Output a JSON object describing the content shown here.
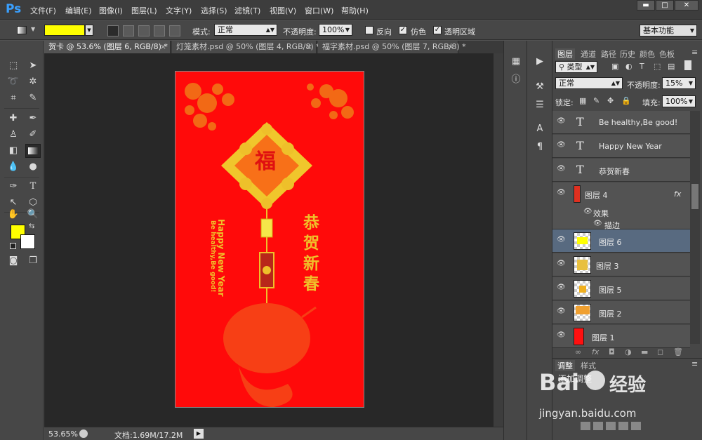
{
  "app": {
    "logo": "Ps"
  },
  "menu": [
    "文件(F)",
    "编辑(E)",
    "图像(I)",
    "图层(L)",
    "文字(Y)",
    "选择(S)",
    "滤镜(T)",
    "视图(V)",
    "窗口(W)",
    "帮助(H)"
  ],
  "window_controls": {
    "minimize": "▬",
    "maximize": "□",
    "close": "✕"
  },
  "options": {
    "gradient_color": "#ffff00",
    "mode_label": "模式:",
    "mode_value": "正常",
    "opacity_label": "不透明度:",
    "opacity_value": "100%",
    "reverse_label": "反向",
    "dither_label": "仿色",
    "transparency_label": "透明区域",
    "workspace": "基本功能"
  },
  "tabs": [
    {
      "label": "贺卡 @ 53.6% (图层 6, RGB/8) *",
      "close": "×"
    },
    {
      "label": "灯笼素材.psd @ 50% (图层 4, RGB/8) *",
      "close": "×"
    },
    {
      "label": "福字素材.psd @ 50% (图层 7, RGB/8) *",
      "close": "×"
    }
  ],
  "card": {
    "fu": "福",
    "happy": "Happy New Year",
    "healthy": "Be healthy,Be good!",
    "greeting": [
      "恭",
      "贺",
      "新",
      "春"
    ]
  },
  "status": {
    "zoom": "53.65%",
    "doc": "文档:1.69M/17.2M"
  },
  "colors": {
    "foreground": "#ffff00",
    "background": "#ffffff",
    "card_red": "#ff0a0a",
    "gold": "#f0c02a",
    "selected_row": "#586a80"
  },
  "layers_panel": {
    "tabs": [
      "图层",
      "通道",
      "路径",
      "历史",
      "颜色",
      "色板"
    ],
    "filter_kind": "类型",
    "blend_mode": "正常",
    "opacity_label": "不透明度:",
    "opacity_value": "15%",
    "lock_label": "锁定:",
    "fill_label": "填充:",
    "fill_value": "100%",
    "layers": [
      {
        "name": "Be healthy,Be good!",
        "type": "text"
      },
      {
        "name": "Happy New Year",
        "type": "text"
      },
      {
        "name": "恭贺新春",
        "type": "text"
      },
      {
        "name": "图层 4",
        "type": "image",
        "fx": "fx",
        "effects_label": "效果",
        "effect": "描边"
      },
      {
        "name": "图层 6",
        "type": "image",
        "selected": true
      },
      {
        "name": "图层 3",
        "type": "image"
      },
      {
        "name": "图层 5",
        "type": "image"
      },
      {
        "name": "图层 2",
        "type": "image"
      },
      {
        "name": "图层 1",
        "type": "fill"
      }
    ],
    "bottom_fx": "fx"
  },
  "adjust_panel": {
    "tabs": [
      "调整",
      "样式"
    ],
    "title": "添加调整"
  },
  "watermark": {
    "brand": "Bai",
    "brand2": "经验",
    "url": "jingyan.baidu.com"
  }
}
